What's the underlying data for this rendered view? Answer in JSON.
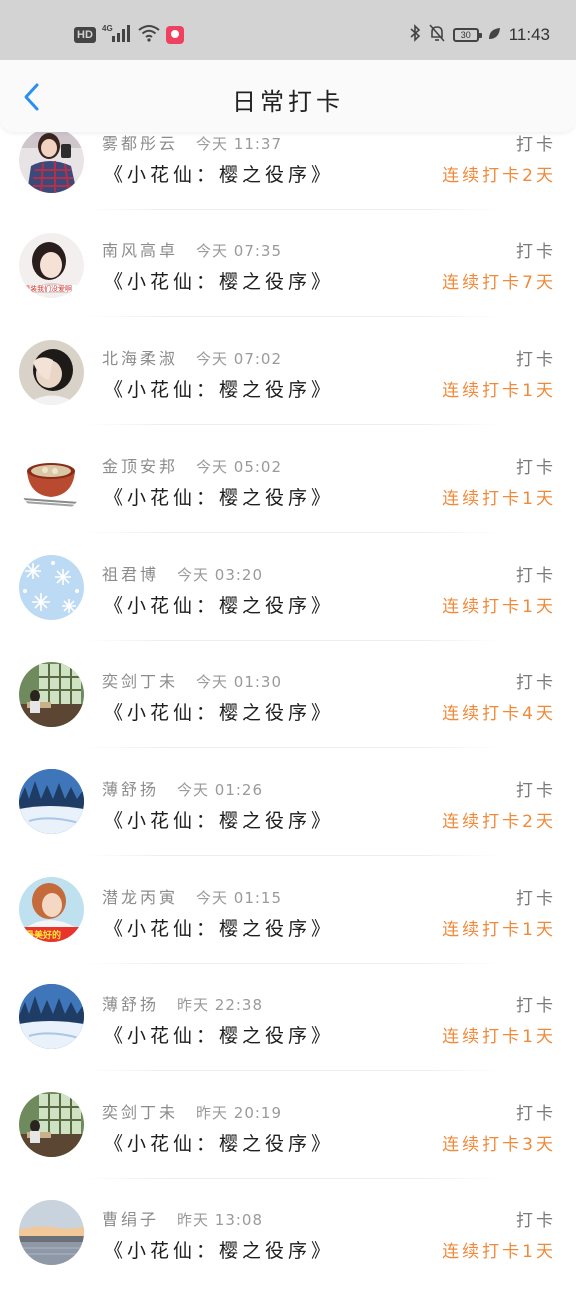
{
  "status_bar": {
    "hd": "HD",
    "network": "4G",
    "battery": "30",
    "time": "11:43",
    "icons": [
      "signal-icon",
      "wifi-icon",
      "app-notification-icon",
      "bluetooth-icon",
      "mute-bell-icon",
      "battery-icon",
      "leaf-icon"
    ]
  },
  "header": {
    "title": "日常打卡",
    "back_icon": "back-chevron-icon",
    "accent": "#2b8ff0"
  },
  "colors": {
    "streak": "#f08a3a",
    "name": "#8c8c8c",
    "book": "#1e1e1e"
  },
  "rows": [
    {
      "name": "雾都彤云",
      "time": "今天 11:37",
      "action": "打卡",
      "book": "《小花仙：樱之役序》",
      "streak": "连续打卡2天",
      "avatar": "avatar-girl-plaid"
    },
    {
      "name": "南风高卓",
      "time": "今天 07:35",
      "action": "打卡",
      "book": "《小花仙：樱之役序》",
      "streak": "连续打卡7天",
      "avatar": "avatar-girl-red-text"
    },
    {
      "name": "北海柔淑",
      "time": "今天 07:02",
      "action": "打卡",
      "book": "《小花仙：樱之役序》",
      "streak": "连续打卡1天",
      "avatar": "avatar-girl-hand"
    },
    {
      "name": "金顶安邦",
      "time": "今天 05:02",
      "action": "打卡",
      "book": "《小花仙：樱之役序》",
      "streak": "连续打卡1天",
      "avatar": "avatar-soup-bowl"
    },
    {
      "name": "祖君博",
      "time": "今天 03:20",
      "action": "打卡",
      "book": "《小花仙：樱之役序》",
      "streak": "连续打卡1天",
      "avatar": "avatar-snowflakes"
    },
    {
      "name": "奕剑丁未",
      "time": "今天 01:30",
      "action": "打卡",
      "book": "《小花仙：樱之役序》",
      "streak": "连续打卡4天",
      "avatar": "avatar-classroom"
    },
    {
      "name": "薄舒扬",
      "time": "今天 01:26",
      "action": "打卡",
      "book": "《小花仙：樱之役序》",
      "streak": "连续打卡2天",
      "avatar": "avatar-snow-forest"
    },
    {
      "name": "潜龙丙寅",
      "time": "今天 01:15",
      "action": "打卡",
      "book": "《小花仙：樱之役序》",
      "streak": "连续打卡1天",
      "avatar": "avatar-girl-orange-hair"
    },
    {
      "name": "薄舒扬",
      "time": "昨天 22:38",
      "action": "打卡",
      "book": "《小花仙：樱之役序》",
      "streak": "连续打卡1天",
      "avatar": "avatar-snow-forest"
    },
    {
      "name": "奕剑丁未",
      "time": "昨天 20:19",
      "action": "打卡",
      "book": "《小花仙：樱之役序》",
      "streak": "连续打卡3天",
      "avatar": "avatar-classroom"
    },
    {
      "name": "曹绢子",
      "time": "昨天 13:08",
      "action": "打卡",
      "book": "《小花仙：樱之役序》",
      "streak": "连续打卡1天",
      "avatar": "avatar-sunset-lake"
    }
  ]
}
